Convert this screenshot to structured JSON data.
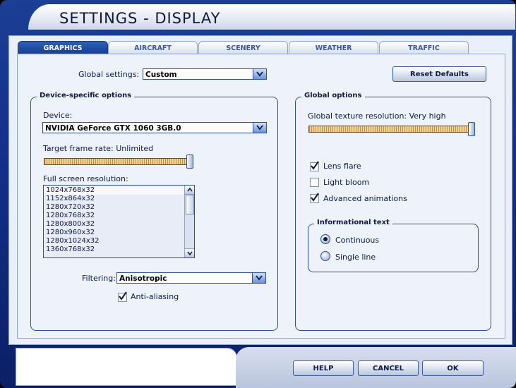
{
  "window": {
    "title": "SETTINGS - DISPLAY"
  },
  "tabs": [
    {
      "label": "GRAPHICS",
      "active": true
    },
    {
      "label": "AIRCRAFT",
      "active": false
    },
    {
      "label": "SCENERY",
      "active": false
    },
    {
      "label": "WEATHER",
      "active": false
    },
    {
      "label": "TRAFFIC",
      "active": false
    }
  ],
  "global_settings": {
    "label": "Global settings:",
    "value": "Custom"
  },
  "reset_button": {
    "label": "Reset Defaults"
  },
  "device_group": {
    "title": "Device-specific options",
    "device_label": "Device:",
    "device_value": "NVIDIA GeForce GTX 1060 3GB.0",
    "frame_rate_label": "Target frame rate: Unlimited",
    "frame_rate_level": 1.0,
    "resolution_label": "Full screen resolution:",
    "resolutions": [
      "1024x768x32",
      "1152x864x32",
      "1280x720x32",
      "1280x768x32",
      "1280x800x32",
      "1280x960x32",
      "1280x1024x32",
      "1360x768x32"
    ],
    "selected_resolution": "1024x768x32",
    "filtering_label": "Filtering:",
    "filtering_value": "Anisotropic",
    "antialiasing_label": "Anti-aliasing",
    "antialiasing_checked": true
  },
  "global_group": {
    "title": "Global options",
    "texture_label": "Global texture resolution: Very high",
    "texture_level": 1.0,
    "lens_flare_label": "Lens flare",
    "lens_flare_checked": true,
    "light_bloom_label": "Light bloom",
    "light_bloom_checked": false,
    "advanced_animations_label": "Advanced animations",
    "advanced_animations_checked": true
  },
  "info_group": {
    "title": "Informational text",
    "options": [
      {
        "label": "Continuous",
        "selected": true
      },
      {
        "label": "Single line",
        "selected": false
      }
    ]
  },
  "footer": {
    "help": "HELP",
    "cancel": "CANCEL",
    "ok": "OK"
  },
  "colors": {
    "accent": "#1b3f95",
    "panel": "#eef2fb",
    "border": "#2b4f9a",
    "slider": "#c28b3f"
  }
}
